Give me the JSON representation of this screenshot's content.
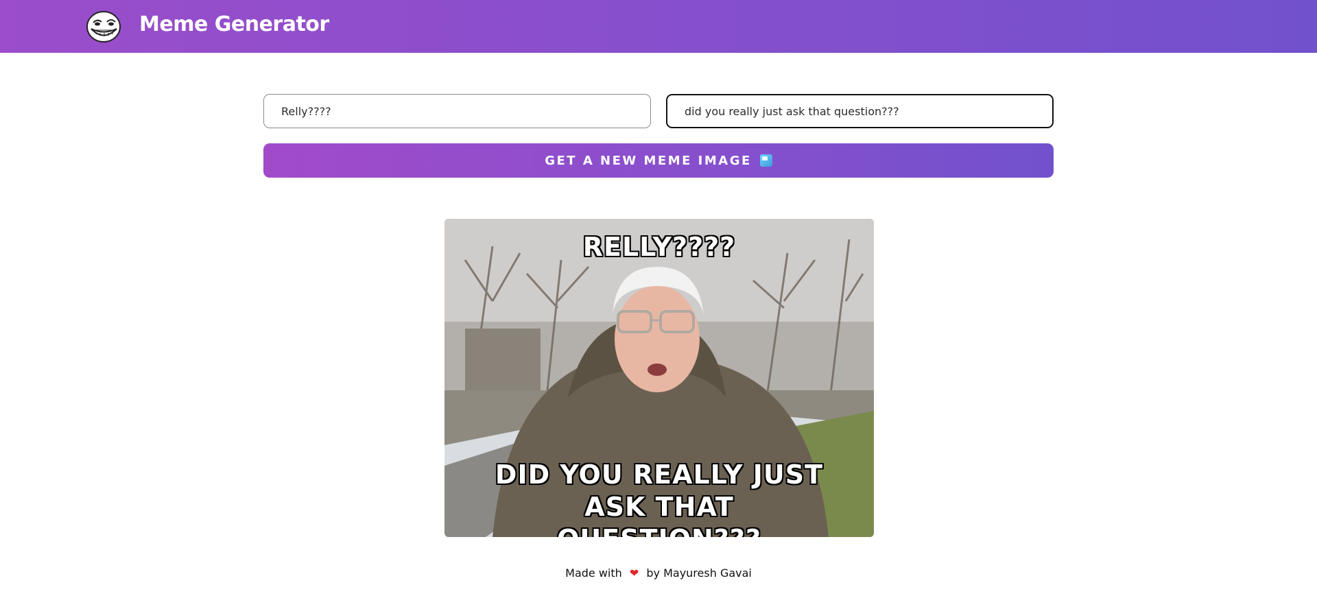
{
  "header": {
    "title": "Meme Generator",
    "logo_icon": "troll-face-icon"
  },
  "form": {
    "top_text_value": "Relly????",
    "bottom_text_value": "did you really just ask that question???",
    "button_label": "GET A NEW MEME IMAGE",
    "button_icon": "framed-picture-icon"
  },
  "meme": {
    "top_caption": "Relly????",
    "bottom_caption": "did you really just ask that question???"
  },
  "footer": {
    "prefix": "Made with",
    "heart": "❤",
    "suffix": "by Mayuresh Gavai"
  },
  "colors": {
    "accent_start": "#9b4dca",
    "accent_end": "#7251cd"
  }
}
